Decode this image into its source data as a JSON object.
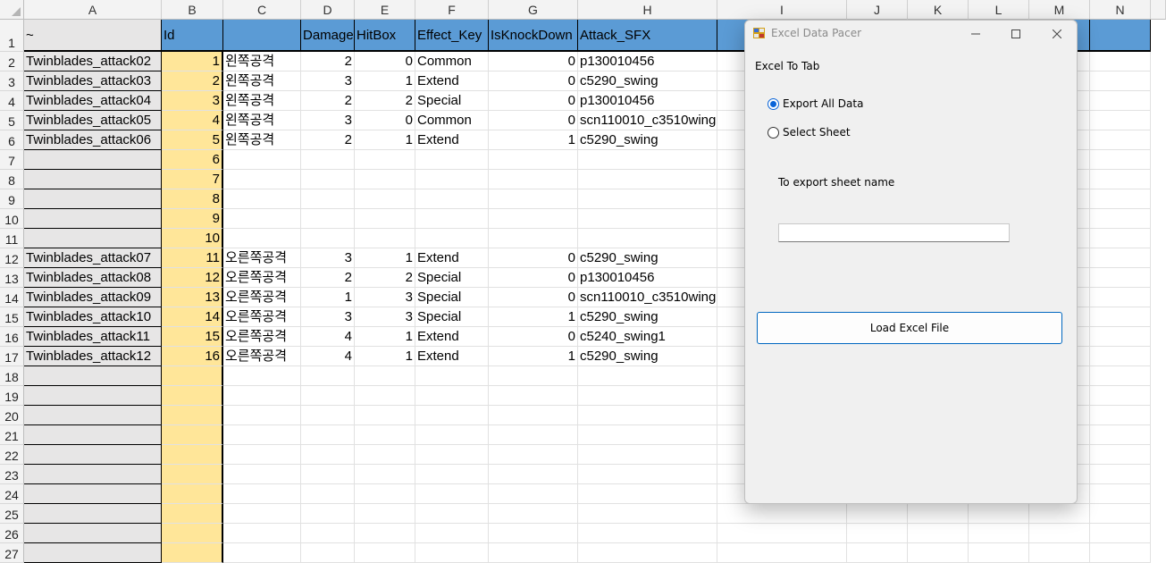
{
  "spreadsheet": {
    "column_letters": [
      "A",
      "B",
      "C",
      "D",
      "E",
      "F",
      "G",
      "H",
      "I",
      "J",
      "K",
      "L",
      "M",
      "N"
    ],
    "headers": [
      "~",
      "Id",
      "",
      "Damage",
      "HitBox",
      "Effect_Key",
      "IsKnockDown",
      "Attack_SFX"
    ],
    "row_numbers": [
      "1",
      "2",
      "3",
      "4",
      "5",
      "6",
      "7",
      "8",
      "9",
      "10",
      "11",
      "12",
      "13",
      "14",
      "15",
      "16",
      "17",
      "18",
      "19",
      "20",
      "21",
      "22",
      "23",
      "24",
      "25",
      "26",
      "27"
    ],
    "rows": [
      [
        "Twinblades_attack02",
        "1",
        "왼쪽공격",
        "2",
        "0",
        "Common",
        "0",
        "p130010456"
      ],
      [
        "Twinblades_attack03",
        "2",
        "왼쪽공격",
        "3",
        "1",
        "Extend",
        "0",
        "c5290_swing"
      ],
      [
        "Twinblades_attack04",
        "3",
        "왼쪽공격",
        "2",
        "2",
        "Special",
        "0",
        "p130010456"
      ],
      [
        "Twinblades_attack05",
        "4",
        "왼쪽공격",
        "3",
        "0",
        "Common",
        "0",
        "scn110010_c3510wing"
      ],
      [
        "Twinblades_attack06",
        "5",
        "왼쪽공격",
        "2",
        "1",
        "Extend",
        "1",
        "c5290_swing"
      ],
      [
        "",
        "6",
        "",
        "",
        "",
        "",
        "",
        ""
      ],
      [
        "",
        "7",
        "",
        "",
        "",
        "",
        "",
        ""
      ],
      [
        "",
        "8",
        "",
        "",
        "",
        "",
        "",
        ""
      ],
      [
        "",
        "9",
        "",
        "",
        "",
        "",
        "",
        ""
      ],
      [
        "",
        "10",
        "",
        "",
        "",
        "",
        "",
        ""
      ],
      [
        "Twinblades_attack07",
        "11",
        "오른쪽공격",
        "3",
        "1",
        "Extend",
        "0",
        "c5290_swing"
      ],
      [
        "Twinblades_attack08",
        "12",
        "오른쪽공격",
        "2",
        "2",
        "Special",
        "0",
        "p130010456"
      ],
      [
        "Twinblades_attack09",
        "13",
        "오른쪽공격",
        "1",
        "3",
        "Special",
        "0",
        "scn110010_c3510wing"
      ],
      [
        "Twinblades_attack10",
        "14",
        "오른쪽공격",
        "3",
        "3",
        "Special",
        "1",
        "c5290_swing"
      ],
      [
        "Twinblades_attack11",
        "15",
        "오른쪽공격",
        "4",
        "1",
        "Extend",
        "0",
        "c5240_swing1"
      ],
      [
        "Twinblades_attack12",
        "16",
        "오른쪽공격",
        "4",
        "1",
        "Extend",
        "1",
        "c5290_swing"
      ]
    ]
  },
  "dialog": {
    "title": "Excel Data Pacer",
    "section_label": "Excel To Tab",
    "radio_export_all": "Export All Data",
    "radio_select_sheet": "Select Sheet",
    "sheet_name_label": "To export sheet name",
    "sheet_name_value": "",
    "load_button": "Load Excel File",
    "accent_color": "#0067c0"
  }
}
